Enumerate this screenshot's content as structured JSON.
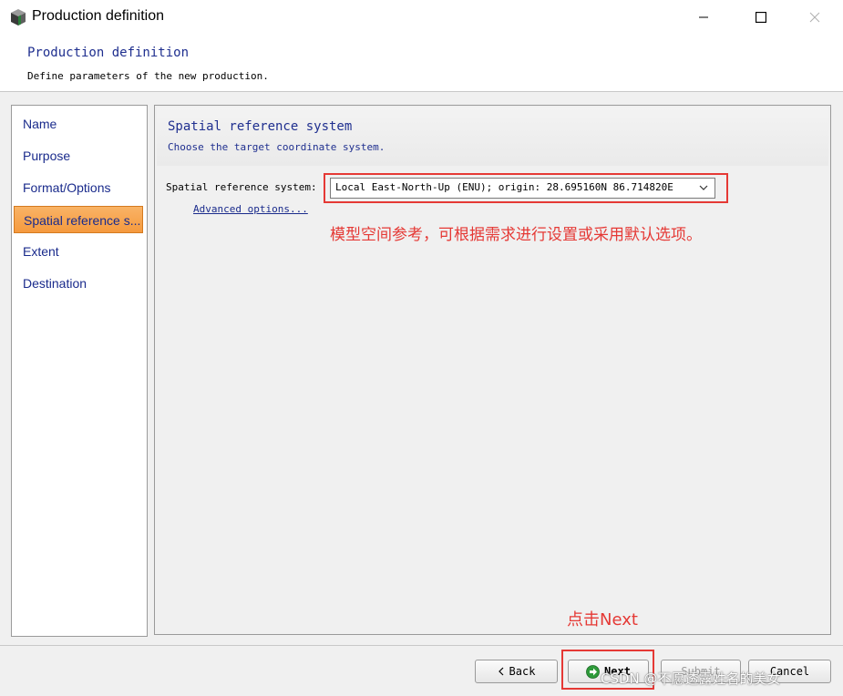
{
  "window": {
    "title": "Production definition"
  },
  "header": {
    "title": "Production definition",
    "subtitle": "Define parameters of the new production."
  },
  "nav": {
    "items": [
      {
        "label": "Name",
        "active": false
      },
      {
        "label": "Purpose",
        "active": false
      },
      {
        "label": "Format/Options",
        "active": false
      },
      {
        "label": "Spatial reference s...",
        "active": true
      },
      {
        "label": "Extent",
        "active": false
      },
      {
        "label": "Destination",
        "active": false
      }
    ]
  },
  "content": {
    "title": "Spatial reference system",
    "subtitle": "Choose the target coordinate system.",
    "srs_label": "Spatial reference system:",
    "srs_value": "Local East-North-Up (ENU); origin: 28.695160N 86.714820E",
    "advanced_link": "Advanced options..."
  },
  "annotations": {
    "srs_note": "模型空间参考，可根据需求进行设置或采用默认选项。",
    "next_note": "点击Next"
  },
  "footer": {
    "back_label": "Back",
    "next_label": "Next",
    "submit_label": "Submit",
    "cancel_label": "Cancel"
  },
  "watermark": "CSDN @不愿透露姓名的美女",
  "colors": {
    "accent_text": "#1f2f8f",
    "active_nav": "#f59a3e",
    "annotation_red": "#e53935"
  }
}
